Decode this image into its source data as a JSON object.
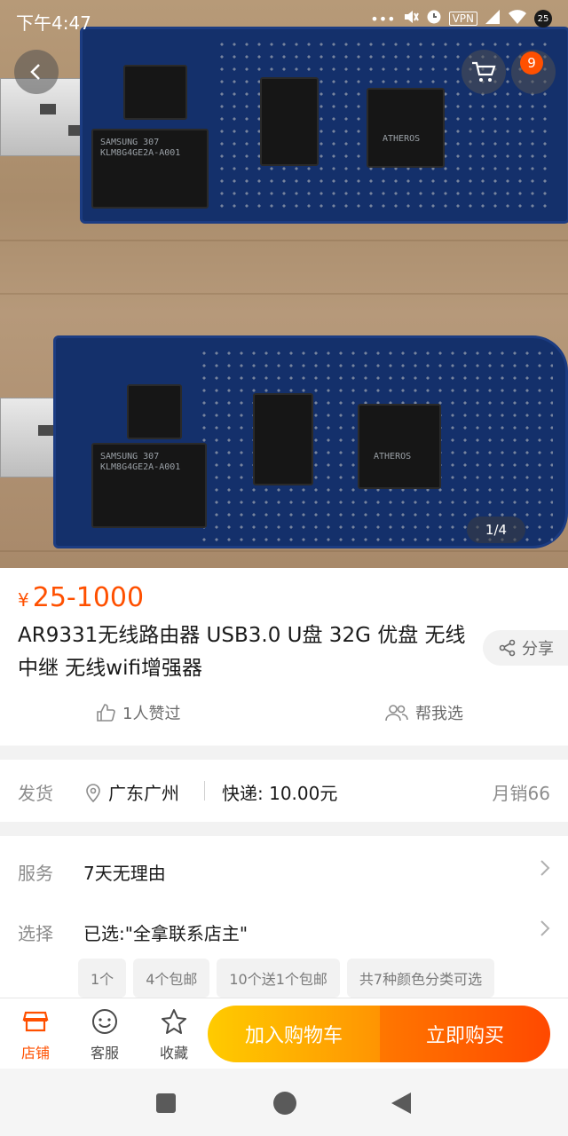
{
  "status_bar": {
    "time": "下午4:47",
    "vpn": "VPN",
    "badge": "25",
    "dots": "•••"
  },
  "top_nav": {
    "back_icon": "chevron-left-icon",
    "cart_icon": "cart-icon",
    "cart_count": "9"
  },
  "image_gallery": {
    "counter": "1/4",
    "board_labels": {
      "flash": "SAMSUNG 307\nKLM8G4GE2A-A001",
      "soc": "ATHEROS"
    }
  },
  "product": {
    "currency": "¥",
    "price": "25-1000",
    "title": "AR9331无线路由器  USB3.0  U盘  32G  优盘  无线中继  无线wifi增强器",
    "share_label": "分享",
    "likes": "1人赞过",
    "help_choose": "帮我选"
  },
  "shipping": {
    "label": "发货",
    "location": "广东广州",
    "fee": "快递: 10.00元",
    "monthly_sales": "月销66"
  },
  "options": {
    "service_label": "服务",
    "service_value": "7天无理由",
    "select_label": "选择",
    "select_value": "已选:\"全拿联系店主\"",
    "tags": [
      "1个",
      "4个包邮",
      "10个送1个包邮",
      "共7种颜色分类可选"
    ]
  },
  "action_bar": {
    "store": "店铺",
    "service": "客服",
    "favorite": "收藏",
    "add_to_cart": "加入购物车",
    "buy_now": "立即购买"
  },
  "colors": {
    "accent": "#ff5000",
    "cart_button": "#ff9402",
    "buy_button": "#ff4900"
  }
}
